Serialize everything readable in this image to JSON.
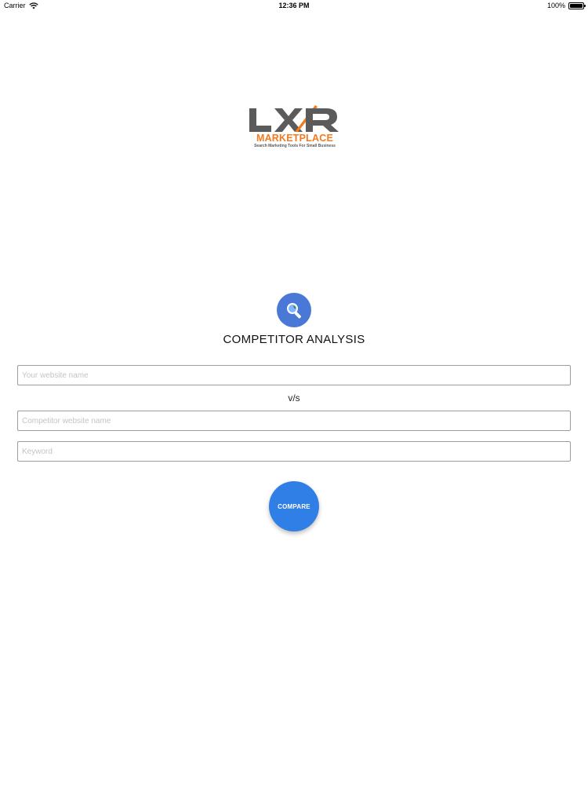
{
  "status_bar": {
    "carrier": "Carrier",
    "time": "12:36 PM",
    "battery": "100%"
  },
  "logo": {
    "wordmark": "LXR",
    "subtitle": "MARKETPLACE",
    "tagline": "Search Marketing Tools For Small Business",
    "colors": {
      "gray": "#5b5b5b",
      "orange": "#f47a20"
    }
  },
  "feature": {
    "icon": "magnifier-icon",
    "title": "COMPETITOR ANALYSIS"
  },
  "form": {
    "your_site_placeholder": "Your website name",
    "vs_label": "v/s",
    "competitor_placeholder": "Competitor website name",
    "keyword_placeholder": "Keyword",
    "compare_label": "COMPARE"
  },
  "colors": {
    "accent": "#2f7fe6",
    "icon_bg": "#4a78d6"
  }
}
